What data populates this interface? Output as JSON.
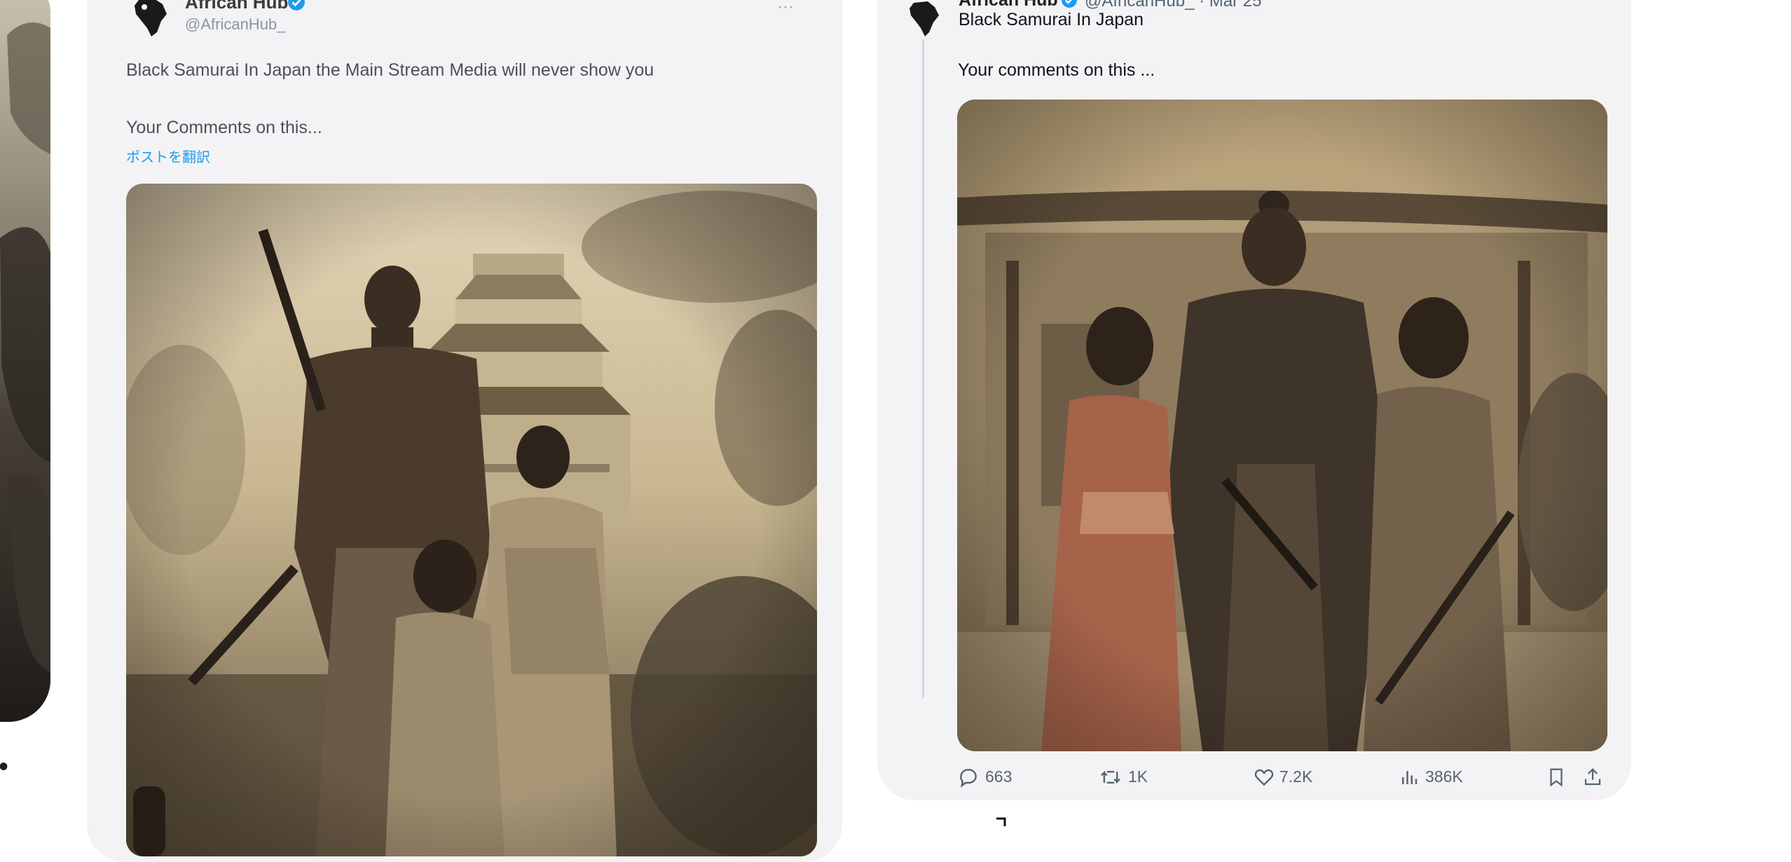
{
  "left_card": {
    "bullet": "•"
  },
  "middle_card": {
    "author_name": "African Hub",
    "author_handle": "@AfricanHub_",
    "more": "···",
    "body_line1": "Black Samurai In Japan the Main Stream Media will never show you",
    "body_line2": "Your Comments on this...",
    "translate_link": "ポストを翻訳"
  },
  "right_card": {
    "author_name": "African Hub",
    "author_handle": "@AfricanHub_ · Mar 25",
    "quoted_title": "Black Samurai In Japan",
    "quoted_comment": "Your comments on this ...",
    "actions": {
      "replies": "663",
      "reposts": "1K",
      "likes": "7.2K",
      "views": "386K"
    }
  },
  "colors": {
    "card_bg": "#f3f3f5",
    "link": "#1d9bf0",
    "muted": "#536471",
    "sepia_light": "#d8c7a6",
    "sepia_dark": "#4a3c2c"
  },
  "icons": [
    "reply-icon",
    "repost-icon",
    "like-icon",
    "views-icon",
    "bookmark-icon",
    "share-icon",
    "verified-icon"
  ]
}
